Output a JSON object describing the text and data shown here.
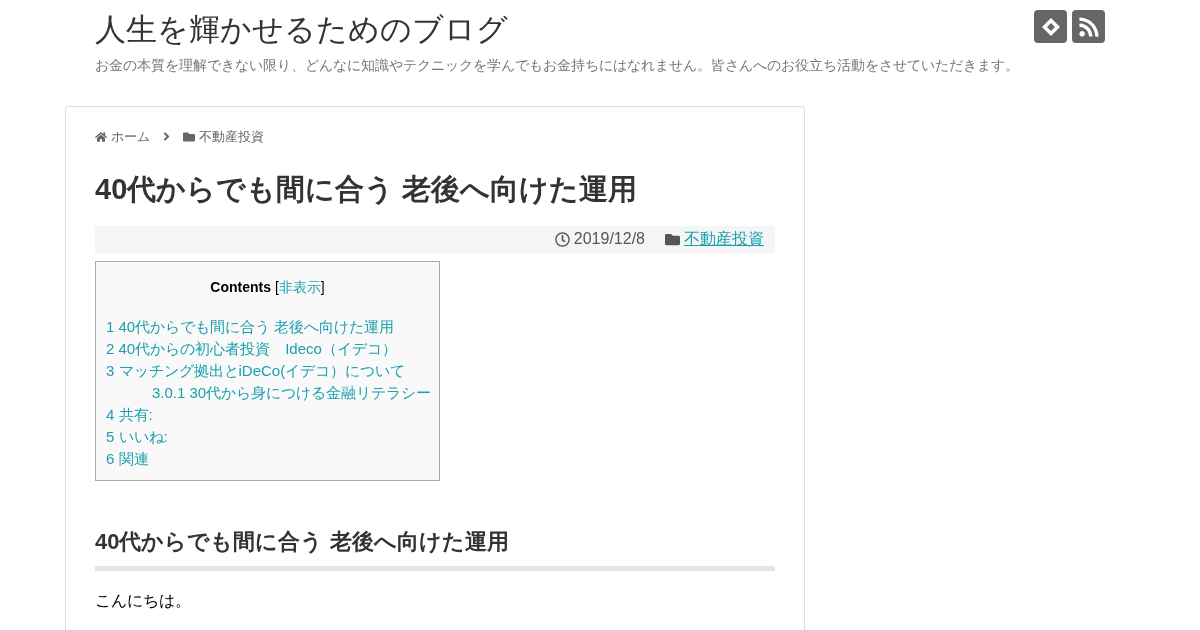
{
  "site": {
    "title": "人生を輝かせるためのブログ",
    "tagline": "お金の本質を理解できない限り、どんなに知識やテクニックを学んでもお金持ちにはなれません。皆さんへのお役立ち活動をさせていただきます。"
  },
  "breadcrumb": [
    {
      "label": "ホーム",
      "kind": "home"
    },
    {
      "label": "不動産投資",
      "kind": "category"
    }
  ],
  "article": {
    "title": "40代からでも間に合う 老後へ向けた運用",
    "date": "2019/12/8",
    "category": "不動産投資"
  },
  "toc": {
    "title": "Contents",
    "open": "[",
    "toggle": "非表示",
    "close": "]",
    "items": [
      {
        "label": "1 40代からでも間に合う 老後へ向けた運用"
      },
      {
        "label": "2 40代からの初心者投資　Ideco（イデコ）"
      },
      {
        "label": "3 マッチング拠出とiDeCo(イデコ）について",
        "children": [
          {
            "label": "3.0.1 30代から身につける金融リテラシー"
          }
        ]
      },
      {
        "label": "4 共有:"
      },
      {
        "label": "5 いいね:"
      },
      {
        "label": "6 関連"
      }
    ]
  },
  "section": {
    "heading": "40代からでも間に合う 老後へ向けた運用",
    "paragraph": "こんにちは。"
  }
}
